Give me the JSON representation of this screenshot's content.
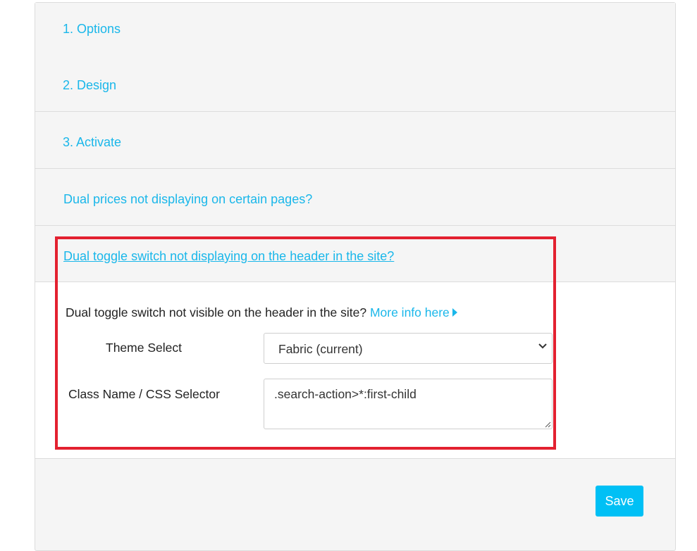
{
  "accordion": {
    "sections": [
      {
        "label": "1. Options"
      },
      {
        "label": "2. Design"
      },
      {
        "label": "3. Activate"
      },
      {
        "label": "Dual prices not displaying on certain pages?"
      },
      {
        "label": "Dual toggle switch not displaying on the header in the site?"
      }
    ]
  },
  "panel": {
    "info_text": "Dual toggle switch not visible on the header in the site?",
    "info_link": "More info here",
    "theme_select_label": "Theme Select",
    "theme_select_value": "Fabric (current)",
    "css_selector_label": "Class Name / CSS Selector",
    "css_selector_value": ".search-action>*:first-child"
  },
  "footer": {
    "save_label": "Save"
  },
  "colors": {
    "link": "#1ab7ea",
    "save_button": "#00c0f5",
    "highlight": "#e32130",
    "header_bg": "#f5f5f5"
  }
}
